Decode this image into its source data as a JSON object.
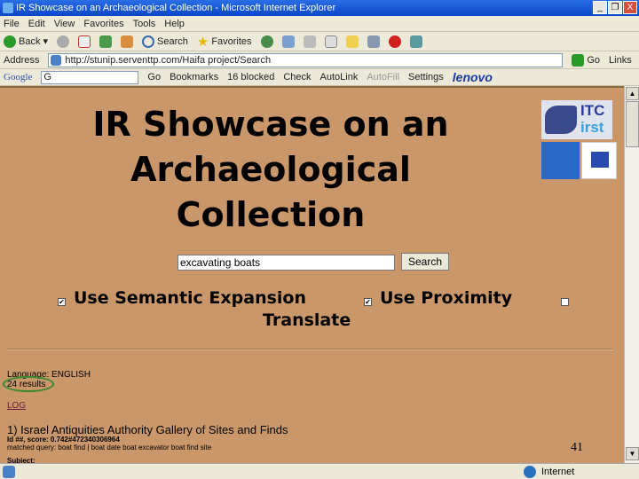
{
  "window": {
    "title": "IR Showcase on an Archaeological Collection - Microsoft Internet Explorer",
    "controls": [
      "_",
      "❐",
      "X"
    ]
  },
  "menu": [
    "File",
    "Edit",
    "View",
    "Favorites",
    "Tools",
    "Help"
  ],
  "toolbar": {
    "back": "Back",
    "search": "Search",
    "favorites": "Favorites"
  },
  "address": {
    "label": "Address",
    "url": "http://stunip.serventtp.com/Haifa project/Search",
    "go": "Go",
    "links": "Links"
  },
  "google": {
    "logo": "Google",
    "input": "G",
    "go": "Go",
    "bookmarks": "Bookmarks",
    "blocked": "16 blocked",
    "check": "Check",
    "autolink": "AutoLink",
    "autofill": "AutoFill",
    "settings": "Settings",
    "brand": "lenovo"
  },
  "page": {
    "title": "IR Showcase on an Archaeological Collection",
    "search_value": "excavating boats",
    "search_button": "Search",
    "opt_semantic": "Use Semantic Expansion",
    "opt_proximity": "Use Proximity",
    "opt_translate": "Translate",
    "semantic_checked": true,
    "proximity_checked": true,
    "translate_checked": false,
    "language": "Language: ENGLISH",
    "results": "24 results",
    "log_link": "LOG",
    "result1_title": "1) Israel Antiquities Authority   Gallery of Sites and Finds",
    "result1_id": "Id ##, score: 0.742#472340306964",
    "result1_matched": "matched query: boat find | boat date   boat excavator   boat find site",
    "result1_subject": "Subject:",
    "slide_number": "41",
    "logo_itc": "ITC irst"
  },
  "status": {
    "zone": "Internet"
  },
  "colors": {
    "page_bg": "#C9976A",
    "highlight_circle": "#3a8a30",
    "link": "#6a1a3a"
  }
}
